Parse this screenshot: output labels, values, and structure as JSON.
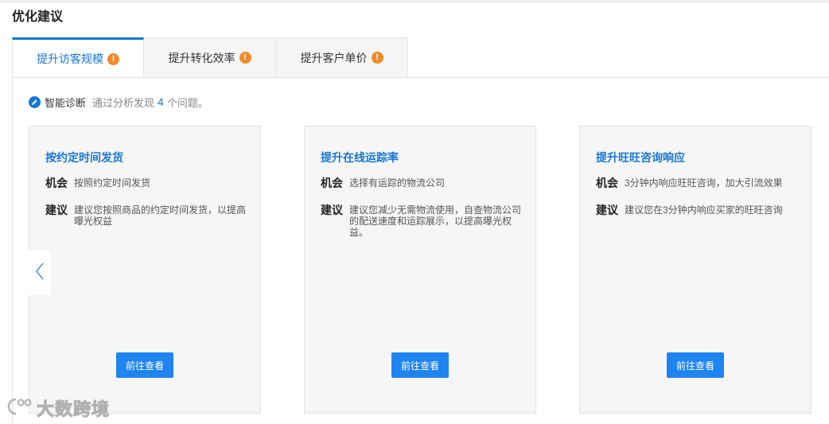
{
  "section_title": "优化建议",
  "tabs": [
    {
      "label": "提升访客规模",
      "active": true,
      "warn": "!"
    },
    {
      "label": "提升转化效率",
      "active": false,
      "warn": "!"
    },
    {
      "label": "提升客户单价",
      "active": false,
      "warn": "!"
    }
  ],
  "diagnosis": {
    "label": "智能诊断",
    "prefix": "通过分析发现",
    "count": "4",
    "suffix": "个问题。"
  },
  "cards": [
    {
      "title": "按约定时间发货",
      "opportunity_label": "机会",
      "opportunity": "按照约定时间发货",
      "suggestion_label": "建议",
      "suggestion": "建议您按照商品的约定时间发货，以提高曝光权益",
      "button": "前往查看"
    },
    {
      "title": "提升在线运踪率",
      "opportunity_label": "机会",
      "opportunity": "选择有运踪的物流公司",
      "suggestion_label": "建议",
      "suggestion": "建议您减少无需物流使用，自查物流公司的配送速度和运踪展示，以提高曝光权益。",
      "button": "前往查看"
    },
    {
      "title": "提升旺旺咨询响应",
      "opportunity_label": "机会",
      "opportunity": "3分钟内响应旺旺咨询，加大引流效果",
      "suggestion_label": "建议",
      "suggestion": "建议您在3分钟内响应买家的旺旺咨询",
      "button": "前往查看"
    }
  ],
  "watermark": "大数跨境",
  "colors": {
    "accent": "#1677d2",
    "button": "#1e84f0",
    "warning": "#f08a2c"
  }
}
